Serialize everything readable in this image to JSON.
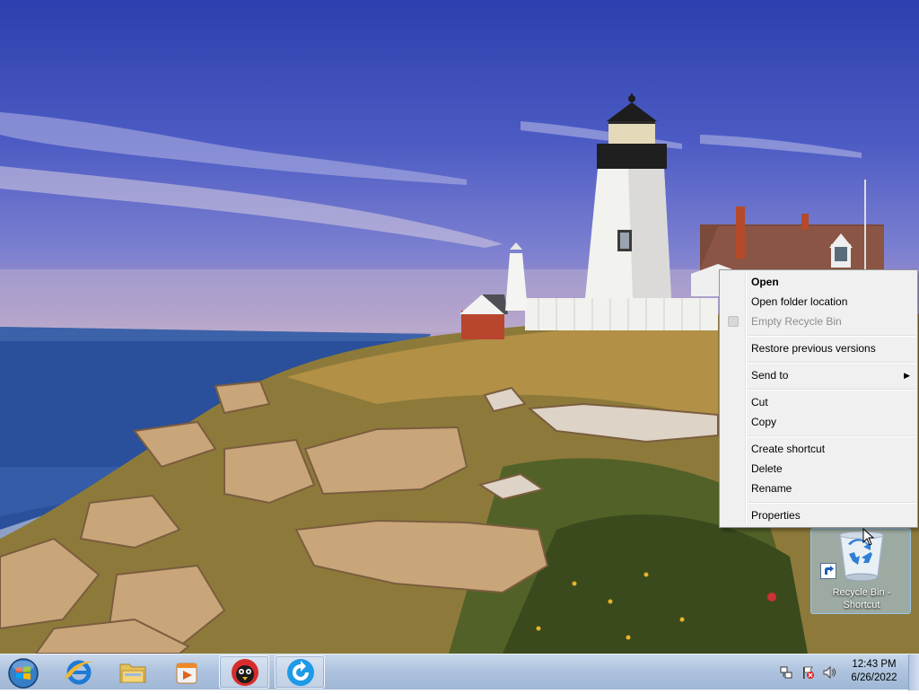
{
  "desktop": {
    "icon": {
      "label": "Recycle Bin -\nShortcut"
    }
  },
  "context_menu": {
    "items": [
      {
        "label": "Open",
        "style": "bold"
      },
      {
        "label": "Open folder location"
      },
      {
        "label": "Empty Recycle Bin",
        "state": "disabled"
      },
      {
        "label": "Restore previous versions"
      },
      {
        "label": "Send to",
        "submenu": true
      },
      {
        "label": "Cut"
      },
      {
        "label": "Copy"
      },
      {
        "label": "Create shortcut"
      },
      {
        "label": "Delete"
      },
      {
        "label": "Rename"
      },
      {
        "label": "Properties"
      }
    ],
    "submenu_arrow": "▶"
  },
  "taskbar": {
    "start_icon": "windows-orb-icon",
    "pinned": [
      {
        "icon": "internet-explorer-icon"
      },
      {
        "icon": "file-explorer-icon"
      },
      {
        "icon": "media-player-icon"
      },
      {
        "icon": "bird-app-icon",
        "state": "open"
      },
      {
        "icon": "blue-refresh-app-icon",
        "state": "open"
      }
    ],
    "tray": {
      "icons": [
        "network-icon",
        "action-center-flag-icon",
        "volume-icon"
      ],
      "time": "12:43 PM",
      "date": "6/26/2022"
    }
  },
  "colors": {
    "taskbar": "#aec3de",
    "menu_bg": "#f0f0f0",
    "disabled_text": "#8d8d8d"
  }
}
